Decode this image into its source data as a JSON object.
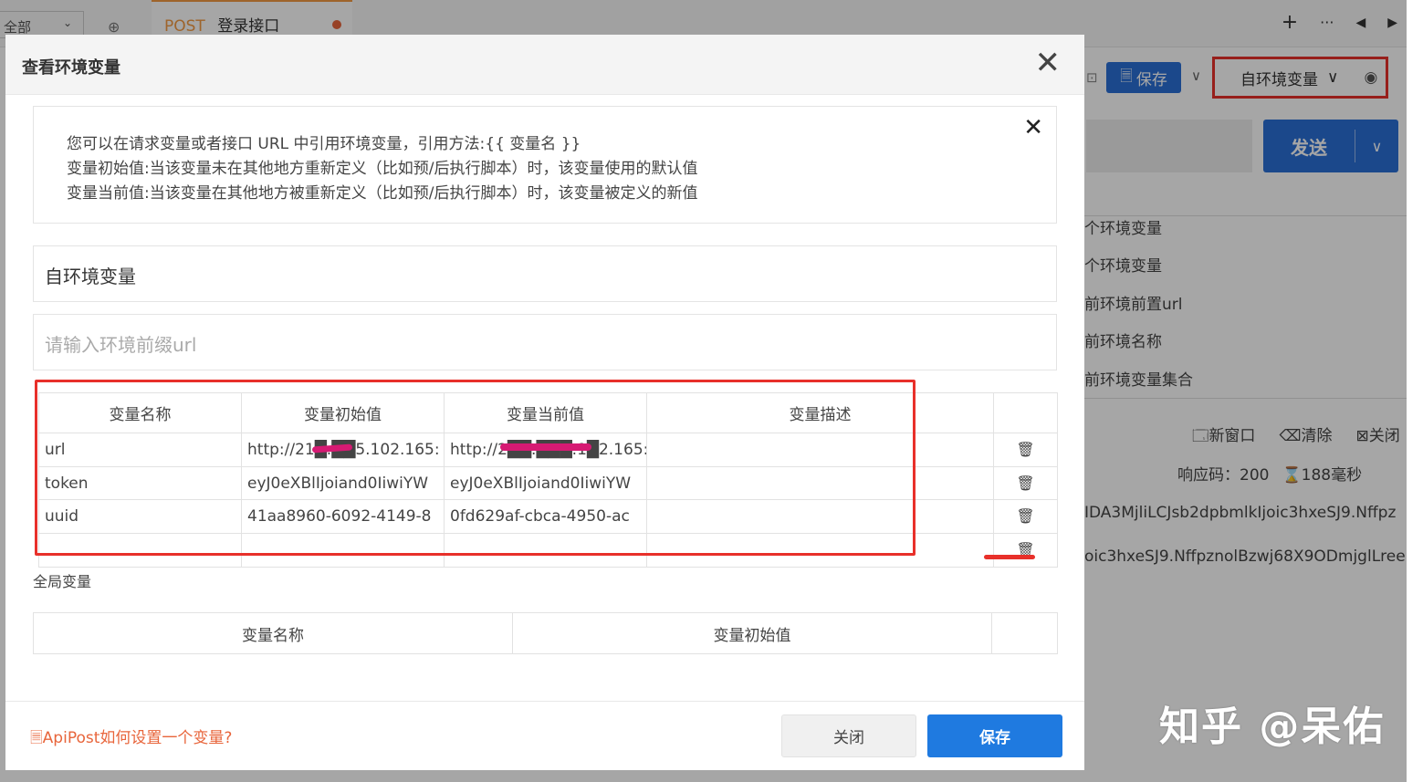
{
  "background": {
    "filter_tab_label": "全部",
    "request_tab": {
      "method": "POST",
      "name": "登录接口"
    },
    "tab_actions": [
      "+",
      "···",
      "◀",
      "▶"
    ],
    "save_label": "保存",
    "env_select_label": "自环境变量",
    "send_label": "发送",
    "side_list": [
      "个环境变量",
      "个环境变量",
      "前环境前置url",
      "前环境名称",
      "前环境变量集合"
    ],
    "action_new_window": "新窗口",
    "action_clear": "清除",
    "action_close": "关闭",
    "status_code": "响应码：200",
    "status_time": "188毫秒",
    "response_line1": "IDA3MjliLCJsb2dpbmlkIjoic3hxeSJ9.Nffpz",
    "response_line2": "oic3hxeSJ9.NffpznolBzwj68X9ODmjglLreer"
  },
  "watermark": "知乎 @呆佑",
  "modal": {
    "title": "查看环境变量",
    "tips": [
      "您可以在请求变量或者接口 URL 中引用环境变量，引用方法:{{ 变量名 }}",
      "变量初始值:当该变量未在其他地方重新定义（比如预/后执行脚本）时，该变量使用的默认值",
      "变量当前值:当该变量在其他地方被重新定义（比如预/后执行脚本）时，该变量被定义的新值"
    ],
    "env_name_value": "自环境变量",
    "url_placeholder": "请输入环境前缀url",
    "table_headers": [
      "变量名称",
      "变量初始值",
      "变量当前值",
      "变量描述"
    ],
    "rows": [
      {
        "name": "url",
        "initial": "http://21█.██5.102.165:",
        "current": "http://2██.███.1█2.165:",
        "desc": ""
      },
      {
        "name": "token",
        "initial": "eyJ0eXBlIjoiand0IiwiYW",
        "current": "eyJ0eXBlIjoiand0IiwiYW",
        "desc": ""
      },
      {
        "name": "uuid",
        "initial": "41aa8960-6092-4149-8",
        "current": "0fd629af-cbca-4950-ac",
        "desc": ""
      },
      {
        "name": "",
        "initial": "",
        "current": "",
        "desc": ""
      }
    ],
    "global_label": "全局变量",
    "global_headers": [
      "变量名称",
      "变量初始值"
    ],
    "help_link": "ApiPost如何设置一个变量?",
    "close_button": "关闭",
    "save_button": "保存"
  }
}
